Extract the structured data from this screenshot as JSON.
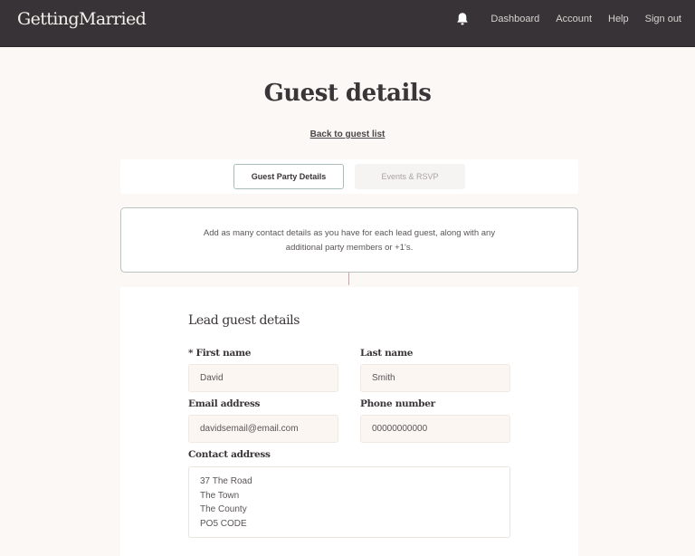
{
  "header": {
    "logo": "GettingMarried",
    "nav": [
      "Dashboard",
      "Account",
      "Help",
      "Sign out"
    ],
    "bell_icon": "bell-icon"
  },
  "page": {
    "title": "Guest details",
    "back_link": "Back to guest list"
  },
  "tabs": [
    {
      "label": "Guest Party Details",
      "active": true
    },
    {
      "label": "Events & RSVP",
      "active": false
    }
  ],
  "info": {
    "text": "Add as many contact details as you have for each lead guest, along with any additional party members or +1's."
  },
  "form": {
    "section_title": "Lead guest details",
    "first_name": {
      "label": "* First name",
      "value": "David"
    },
    "last_name": {
      "label": "Last name",
      "value": "Smith"
    },
    "email": {
      "label": "Email address",
      "value": "davidsemail@email.com"
    },
    "phone": {
      "label": "Phone number",
      "value": "00000000000"
    },
    "address": {
      "label": "Contact address",
      "lines": [
        "37 The Road",
        "The Town",
        "The County",
        "PO5 CODE"
      ]
    }
  },
  "colors": {
    "header_bg": "#383336",
    "page_bg": "#fcf8f5",
    "active_tab_border": "#a9bcbc",
    "field_bg": "#fbf6f2",
    "connector": "#c9a5a8"
  }
}
